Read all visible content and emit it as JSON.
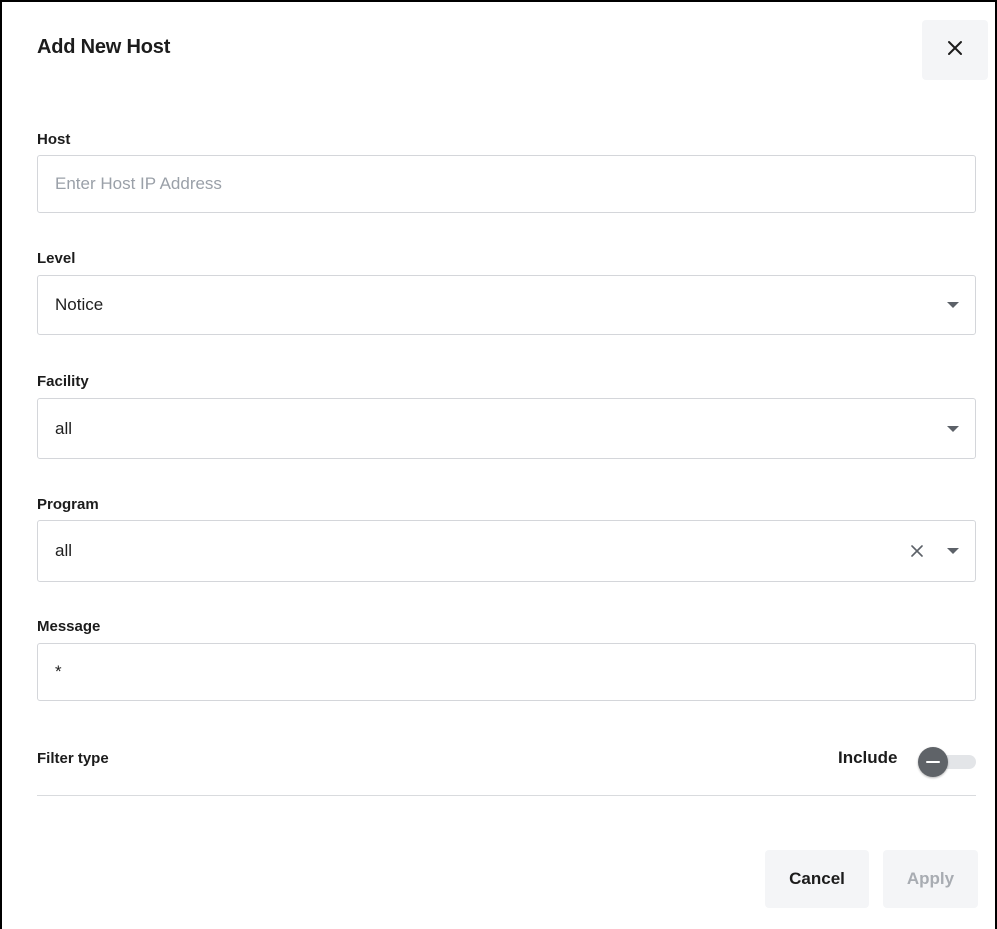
{
  "dialog": {
    "title": "Add New Host",
    "close_icon": "close-icon"
  },
  "fields": {
    "host": {
      "label": "Host",
      "value": "",
      "placeholder": "Enter Host IP Address"
    },
    "level": {
      "label": "Level",
      "value": "Notice"
    },
    "facility": {
      "label": "Facility",
      "value": "all"
    },
    "program": {
      "label": "Program",
      "value": "all"
    },
    "message": {
      "label": "Message",
      "value": "*"
    }
  },
  "filter": {
    "label": "Filter type",
    "toggle_label": "Include",
    "toggle_on": false
  },
  "footer": {
    "cancel_label": "Cancel",
    "apply_label": "Apply"
  },
  "colors": {
    "apply_disabled_text": "#a8acb2",
    "button_bg": "#f4f5f7",
    "toggle_knob": "#5f6368",
    "toggle_track": "#e3e5e8"
  }
}
